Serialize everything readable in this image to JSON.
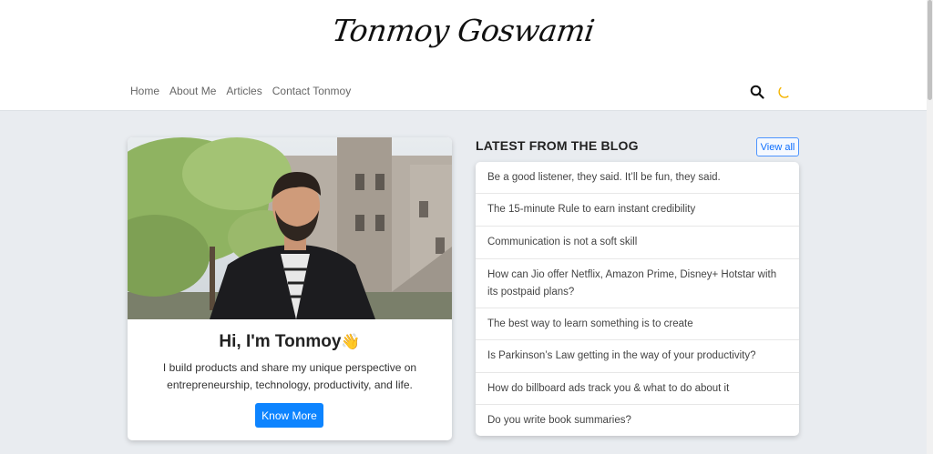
{
  "site": {
    "logo_text": "Tonmoy Goswami"
  },
  "nav": {
    "items": [
      "Home",
      "About Me",
      "Articles",
      "Contact Tonmoy"
    ]
  },
  "icons": {
    "search": "search-icon",
    "theme": "moon-icon"
  },
  "colors": {
    "accent": "#0d84ff",
    "moon": "#f4b400",
    "background": "#e9ecf0"
  },
  "profile": {
    "greeting": "Hi, I'm Tonmoy",
    "wave_emoji": "👋",
    "bio": "I build products and share my unique perspective on entrepreneurship, technology, productivity, and life.",
    "button_label": "Know More"
  },
  "blog": {
    "heading": "LATEST FROM THE BLOG",
    "view_all_label": "View all",
    "posts": [
      "Be a good listener, they said. It’ll be fun, they said.",
      "The 15-minute Rule to earn instant credibility",
      "Communication is not a soft skill",
      "How can Jio offer Netflix, Amazon Prime, Disney+ Hotstar with its postpaid plans?",
      "The best way to learn something is to create",
      "Is Parkinson’s Law getting in the way of your productivity?",
      "How do billboard ads track you & what to do about it",
      "Do you write book summaries?"
    ]
  }
}
